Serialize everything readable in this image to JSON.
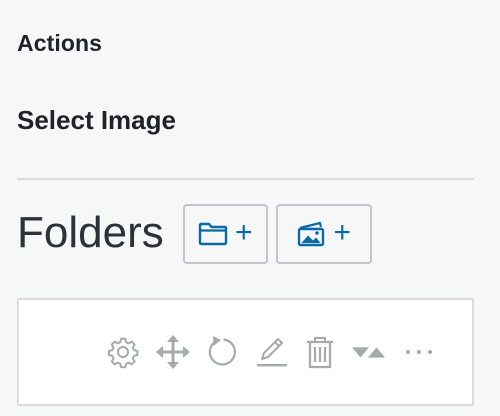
{
  "sidebar": {
    "actions_heading": "Actions",
    "select_image_label": "Select Image"
  },
  "folders": {
    "title": "Folders",
    "new_folder_plus": "+",
    "new_media_folder_plus": "+"
  },
  "toolbar": {
    "icons": [
      "gear-icon",
      "move-icon",
      "refresh-icon",
      "edit-icon",
      "trash-icon",
      "sort-icon",
      "more-icon"
    ],
    "icon_color": "#a7aaad"
  },
  "colors": {
    "accent": "#0a6aa8",
    "background": "#f6f7f7",
    "text": "#1d2327"
  }
}
